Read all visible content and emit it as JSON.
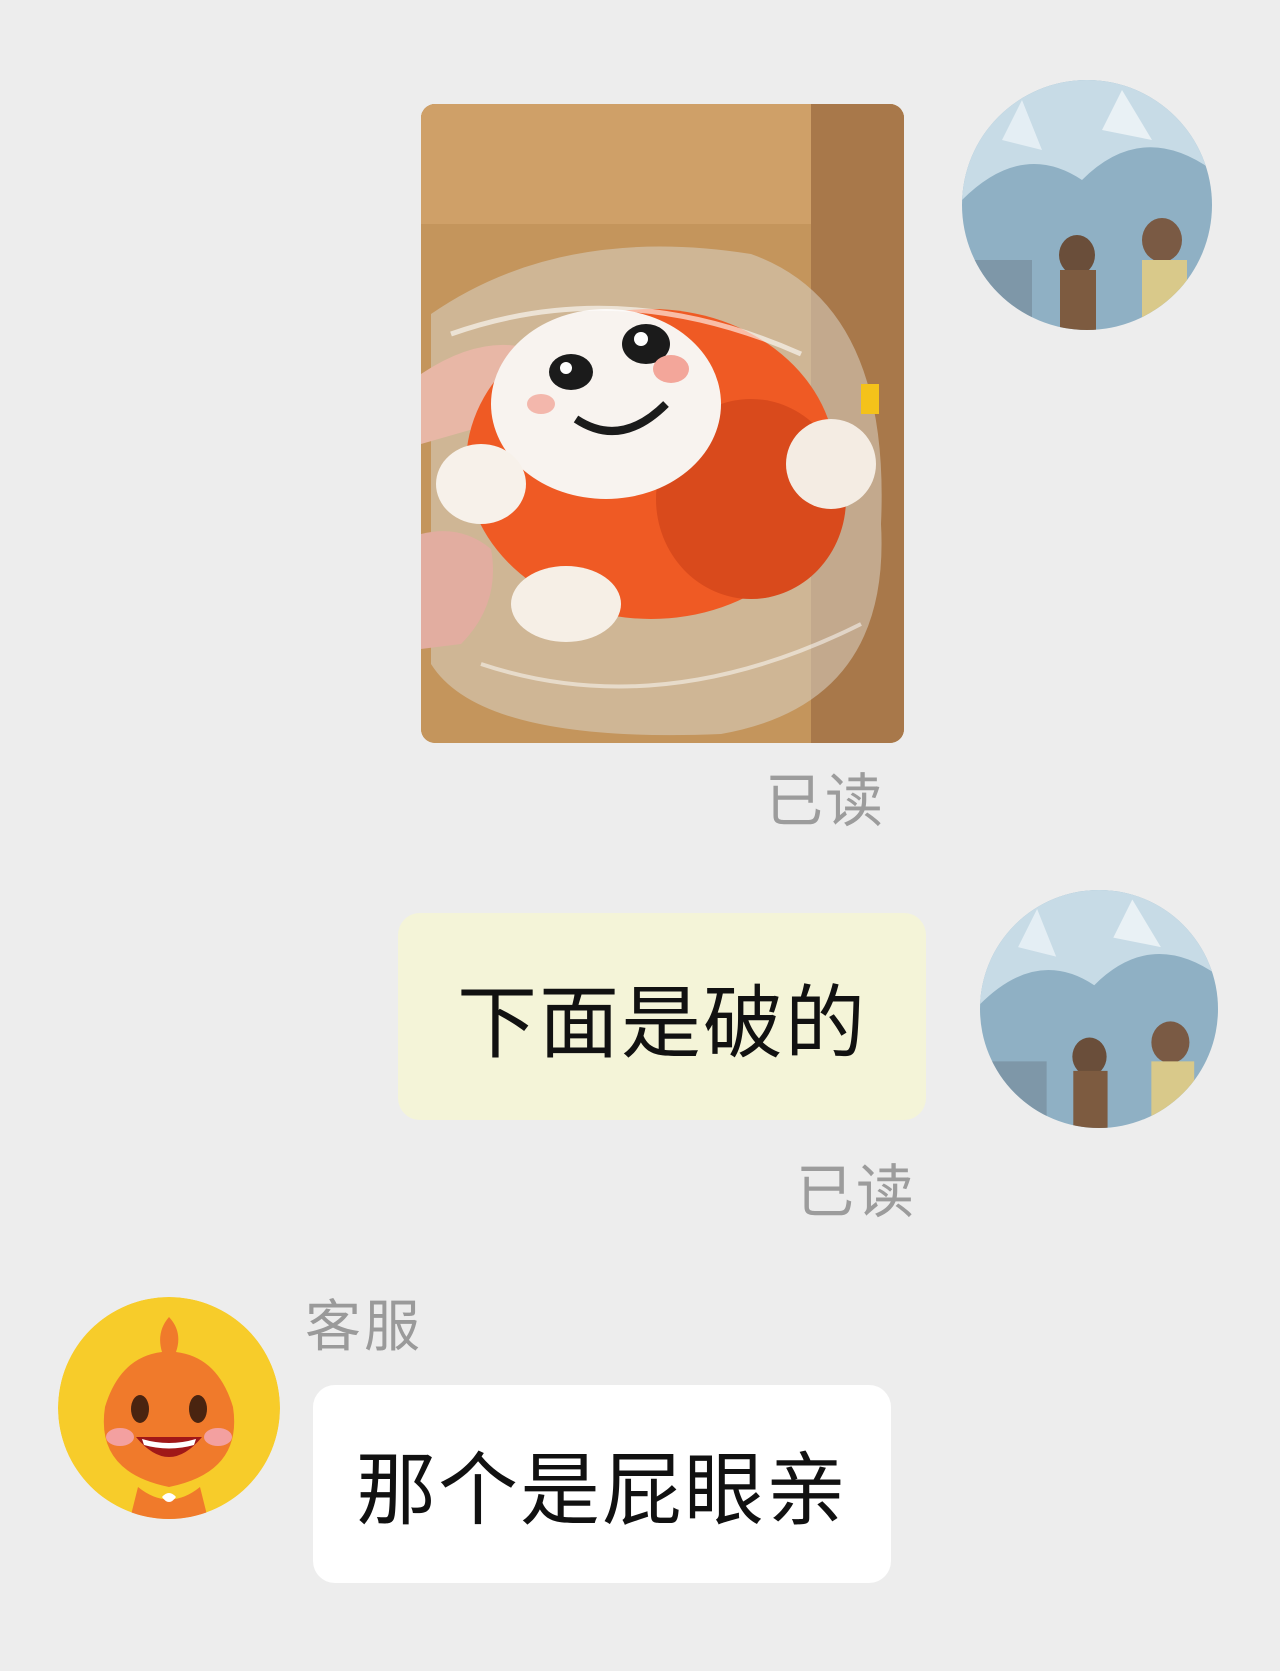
{
  "messages": [
    {
      "id": "msg-1",
      "side": "right",
      "type": "image",
      "image_subject": "orange plush toy in plastic bag",
      "read_status": "已读"
    },
    {
      "id": "msg-2",
      "side": "right",
      "type": "text",
      "text": "下面是破的",
      "read_status": "已读"
    },
    {
      "id": "msg-3",
      "side": "left",
      "type": "text",
      "sender": "客服",
      "text": "那个是屁眼亲"
    }
  ],
  "colors": {
    "background": "#ededed",
    "my_bubble": "#f4f4d8",
    "their_bubble": "#ffffff",
    "read_receipt": "#9c9c9c",
    "mascot_orange": "#f07a2b",
    "mascot_ring": "#f7cc2a"
  },
  "icons": {
    "my_avatar": "sky-scene-avatar",
    "cs_avatar": "orange-mascot-avatar"
  }
}
